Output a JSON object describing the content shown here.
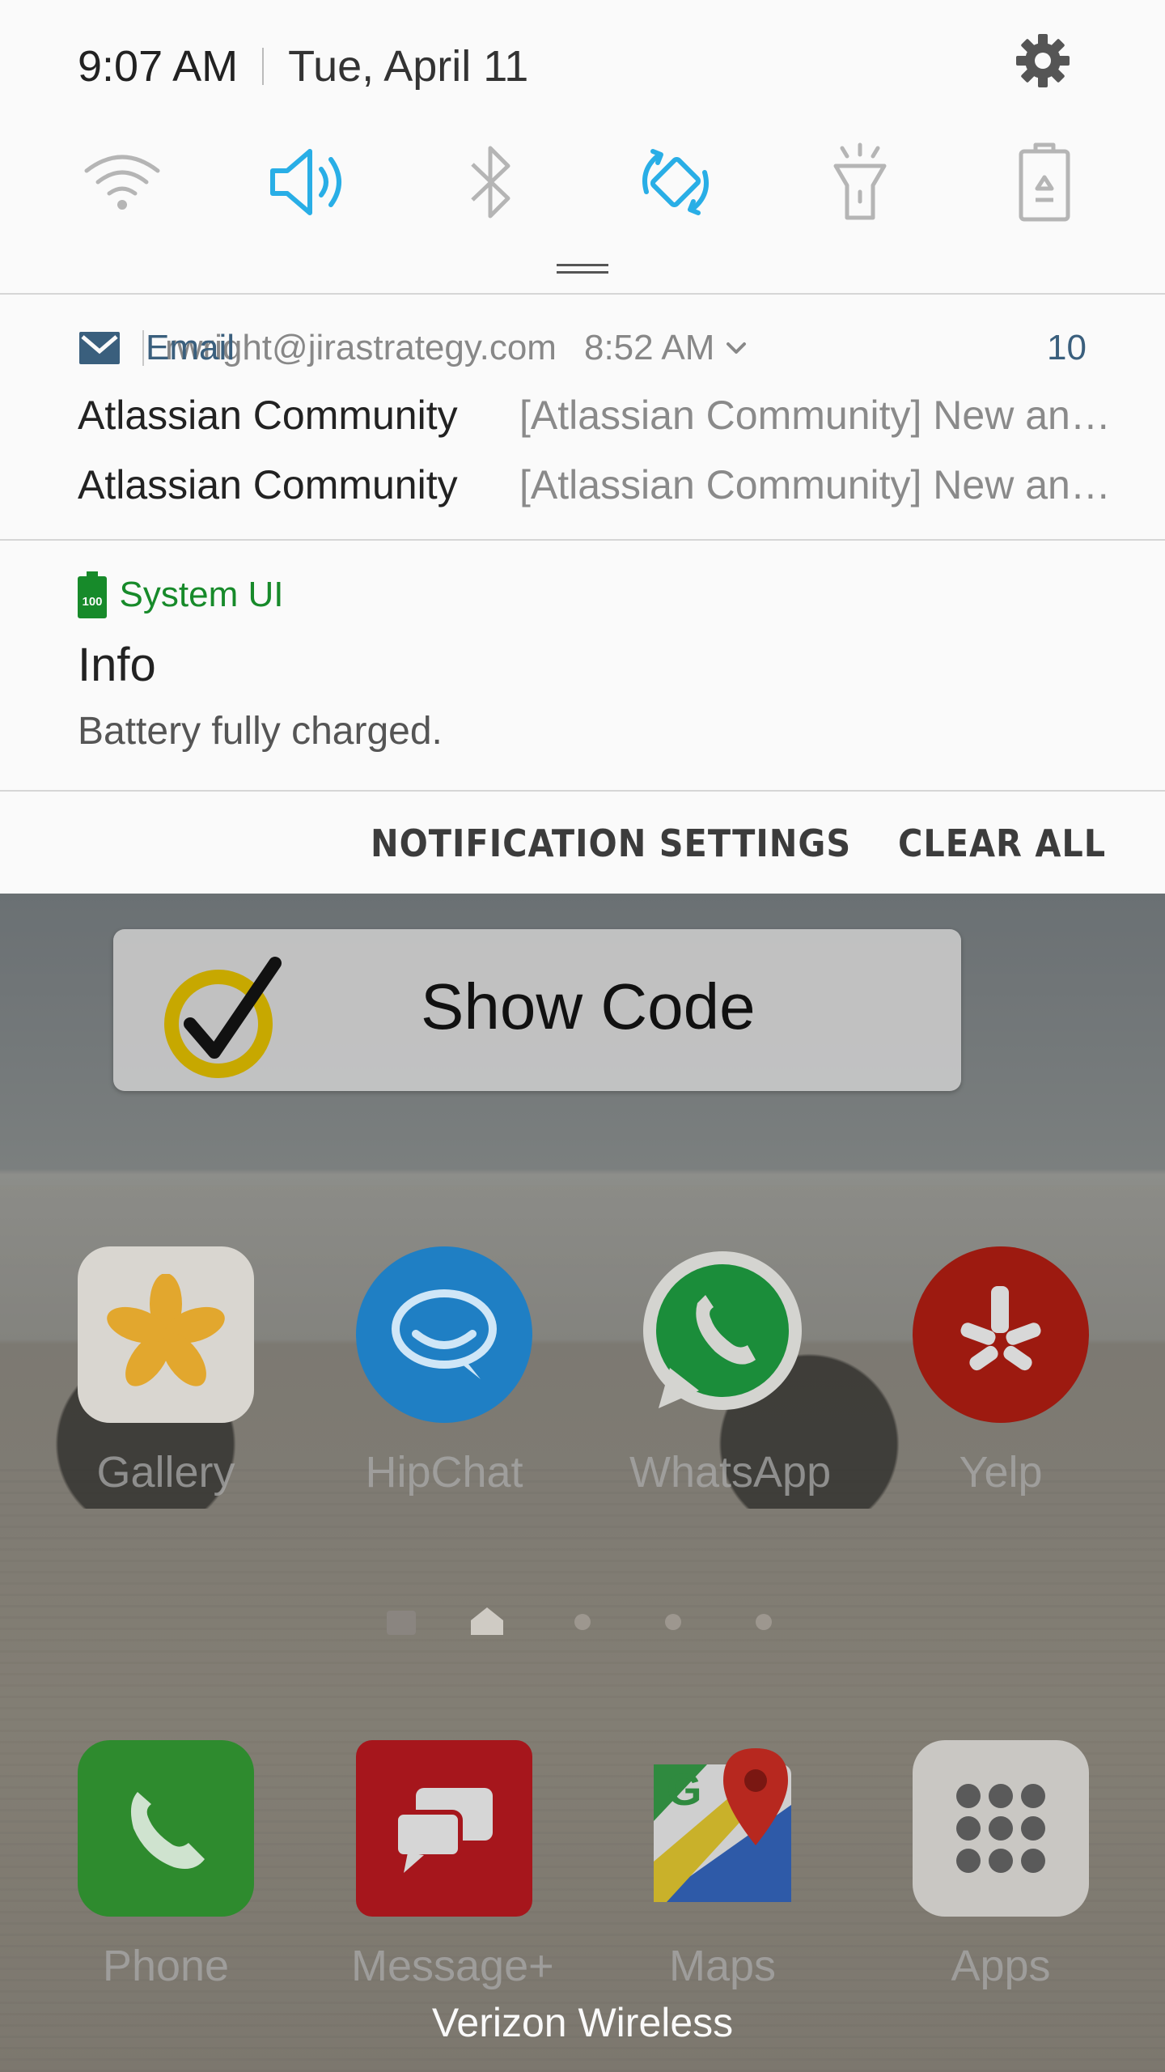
{
  "status": {
    "time": "9:07 AM",
    "date": "Tue, April 11"
  },
  "quick_toggles": [
    {
      "name": "wifi",
      "icon": "wifi-icon",
      "active": false
    },
    {
      "name": "sound",
      "icon": "volume-icon",
      "active": true
    },
    {
      "name": "bluetooth",
      "icon": "bluetooth-icon",
      "active": false
    },
    {
      "name": "auto-rotate",
      "icon": "rotate-icon",
      "active": true
    },
    {
      "name": "flashlight",
      "icon": "flashlight-icon",
      "active": false
    },
    {
      "name": "power-saving",
      "icon": "battery-recycle-icon",
      "active": false
    }
  ],
  "email_notification": {
    "app": "Email",
    "account": "rwright@jirastrategy.com",
    "time": "8:52 AM",
    "count": "10",
    "messages": [
      {
        "from": "Atlassian Community",
        "subject": "[Atlassian Community] New answer posted"
      },
      {
        "from": "Atlassian Community",
        "subject": "[Atlassian Community] New answer posted"
      }
    ]
  },
  "system_notification": {
    "app": "System UI",
    "battery_badge": "100",
    "title": "Info",
    "body": "Battery fully charged."
  },
  "footer": {
    "settings_label": "NOTIFICATION SETTINGS",
    "clear_label": "CLEAR ALL"
  },
  "widget": {
    "label": "Show Code"
  },
  "apps_row1": [
    {
      "label": "Gallery",
      "icon": "gallery-icon"
    },
    {
      "label": "HipChat",
      "icon": "hipchat-icon"
    },
    {
      "label": "WhatsApp",
      "icon": "whatsapp-icon"
    },
    {
      "label": "Yelp",
      "icon": "yelp-icon"
    }
  ],
  "dock": [
    {
      "label": "Phone",
      "icon": "phone-icon"
    },
    {
      "label": "Message+",
      "icon": "message-icon"
    },
    {
      "label": "Maps",
      "icon": "maps-icon"
    },
    {
      "label": "Apps",
      "icon": "apps-grid-icon"
    }
  ],
  "carrier": "Verizon Wireless",
  "colors": {
    "accent_blue": "#29aee6",
    "inactive_icon": "#b5b5b5",
    "email_blue": "#3a5f7d",
    "system_green": "#178a2a"
  }
}
